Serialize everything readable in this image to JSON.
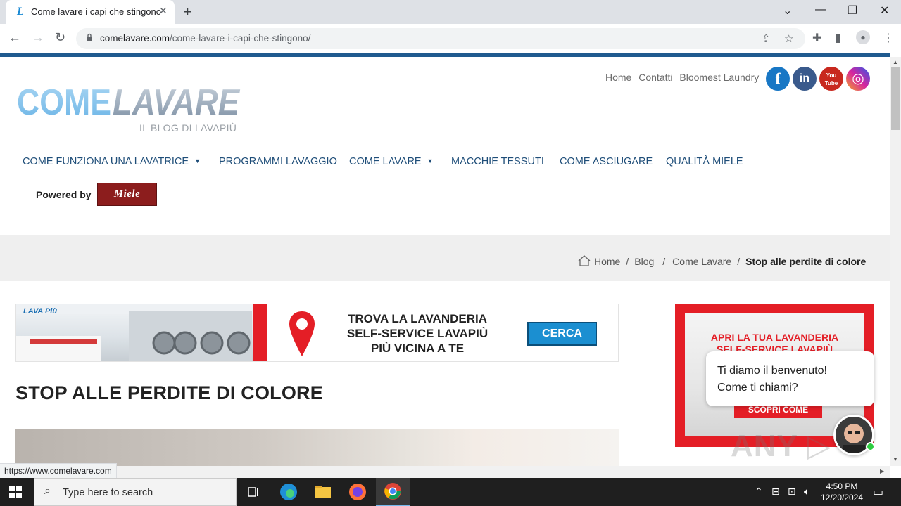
{
  "browser": {
    "tab_title": "Come lavare i capi che stingono",
    "tab_favicon_letter": "L",
    "url_host": "comelavare.com",
    "url_path": "/come-lavare-i-capi-che-stingono/",
    "status_url": "https://www.comelavare.com"
  },
  "site": {
    "logo_text_left": "COME",
    "logo_text_right": "LAVARE",
    "logo_sub": "IL BLOG DI LAVAPIÙ",
    "toplinks": [
      "Home",
      "Contatti",
      "Bloomest Laundry"
    ],
    "social": [
      {
        "name": "facebook",
        "glyph": "f",
        "color": "#1877c5"
      },
      {
        "name": "linkedin",
        "glyph": "in",
        "color": "#3a5a8c"
      },
      {
        "name": "youtube",
        "glyph": "You Tube",
        "color": "#c8281e"
      },
      {
        "name": "instagram",
        "glyph": "◎",
        "color": "#c13584"
      }
    ],
    "nav": [
      {
        "label": "COME FUNZIONA UNA LAVATRICE",
        "dropdown": true
      },
      {
        "label": "PROGRAMMI LAVAGGIO",
        "dropdown": false
      },
      {
        "label": "COME LAVARE",
        "dropdown": true
      },
      {
        "label": "MACCHIE TESSUTI",
        "dropdown": false
      },
      {
        "label": "COME ASCIUGARE",
        "dropdown": false
      },
      {
        "label": "QUALITÀ MIELE",
        "dropdown": false
      }
    ],
    "powered_by": "Powered by",
    "miele": "Miele",
    "breadcrumb": {
      "home": "Home",
      "blog": "Blog",
      "section": "Come Lavare",
      "current": "Stop alle perdite di colore"
    },
    "banner": {
      "line1": "TROVA LA LAVANDERIA",
      "line2": "SELF-SERVICE LAVAPIÙ",
      "line3": "PIÙ VICINA A TE",
      "button": "CERCA"
    },
    "title": "STOP ALLE PERDITE DI COLORE",
    "side_ad": {
      "line1": "APRI LA TUA LAVANDERIA",
      "line2": "SELF-SERVICE LAVAPIÙ",
      "button": "SCOPRI COME"
    },
    "chat": {
      "line1": "Ti diamo il benvenuto!",
      "line2": "Come ti chiami?"
    }
  },
  "taskbar": {
    "search_placeholder": "Type here to search",
    "time": "4:50 PM",
    "date": "12/20/2024"
  },
  "colors": {
    "nav_text": "#1f4e79",
    "accent_red": "#e41e26",
    "cta_blue": "#1b8fd1"
  }
}
